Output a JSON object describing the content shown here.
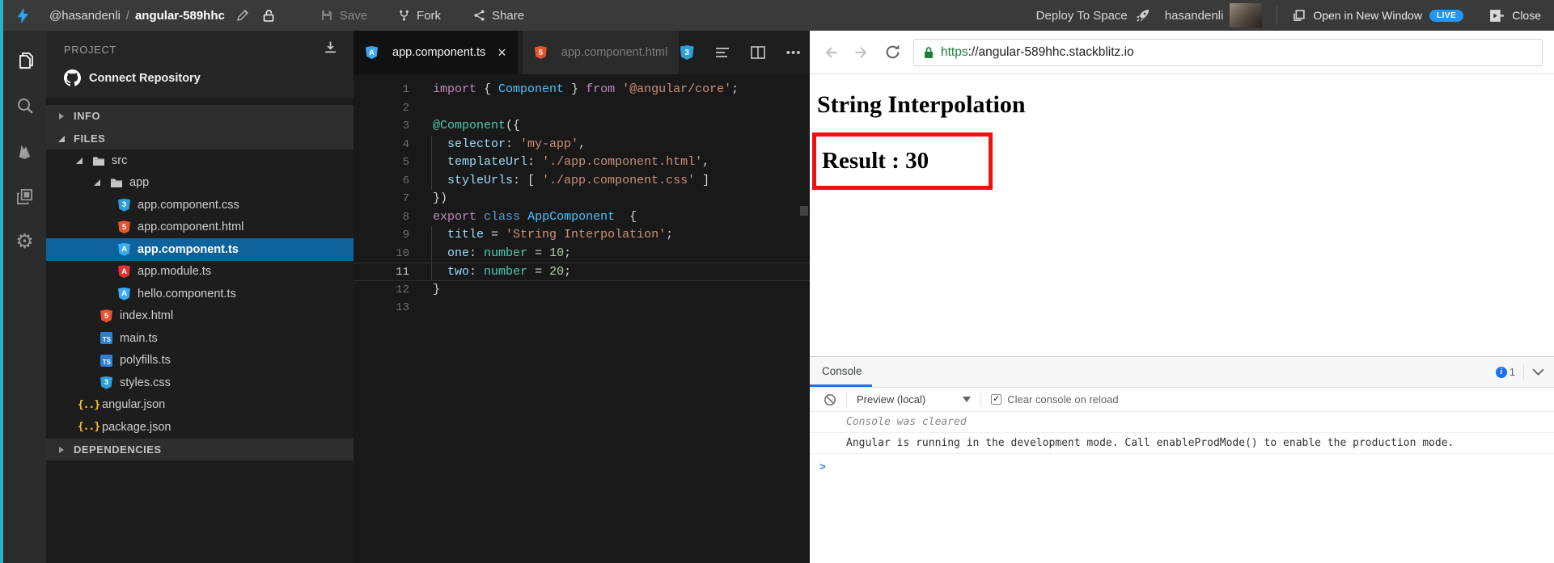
{
  "topbar": {
    "username": "@hasandenli",
    "separator": "/",
    "project_name": "angular-589hhc",
    "save_label": "Save",
    "fork_label": "Fork",
    "share_label": "Share",
    "deploy_label": "Deploy To Space",
    "user_display_name": "hasandenli",
    "open_in_new_window_label": "Open in New Window",
    "live_badge": "LIVE",
    "close_label": "Close"
  },
  "activity_bar": {
    "icons": [
      "files-icon",
      "search-icon",
      "firebase-icon",
      "extensions-icon",
      "settings-icon"
    ]
  },
  "project_panel": {
    "title": "PROJECT",
    "connect_repository_label": "Connect Repository",
    "tree": [
      {
        "label": "INFO",
        "kind": "section",
        "state": "collapsed"
      },
      {
        "label": "FILES",
        "kind": "section",
        "state": "expanded"
      },
      {
        "label": "src",
        "kind": "folder",
        "indent": 1,
        "state": "expanded"
      },
      {
        "label": "app",
        "kind": "folder",
        "indent": 2,
        "state": "expanded"
      },
      {
        "label": "app.component.css",
        "kind": "file",
        "icon": "css3-icon",
        "indent": 3
      },
      {
        "label": "app.component.html",
        "kind": "file",
        "icon": "html5-icon",
        "indent": 3
      },
      {
        "label": "app.component.ts",
        "kind": "file",
        "icon": "angular-blue-icon",
        "indent": 3,
        "selected": true
      },
      {
        "label": "app.module.ts",
        "kind": "file",
        "icon": "angular-red-icon",
        "indent": 3
      },
      {
        "label": "hello.component.ts",
        "kind": "file",
        "icon": "angular-blue-icon",
        "indent": 3
      },
      {
        "label": "index.html",
        "kind": "file",
        "icon": "html5-icon",
        "indent": 2
      },
      {
        "label": "main.ts",
        "kind": "file",
        "icon": "typescript-icon",
        "indent": 2
      },
      {
        "label": "polyfills.ts",
        "kind": "file",
        "icon": "typescript-icon",
        "indent": 2
      },
      {
        "label": "styles.css",
        "kind": "file",
        "icon": "css3-icon",
        "indent": 2
      },
      {
        "label": "angular.json",
        "kind": "file",
        "icon": "json-braces-icon",
        "indent": 1
      },
      {
        "label": "package.json",
        "kind": "file",
        "icon": "json-braces-icon",
        "indent": 1
      },
      {
        "label": "DEPENDENCIES",
        "kind": "section",
        "state": "collapsed"
      }
    ]
  },
  "editor": {
    "tabs": [
      {
        "label": "app.component.ts",
        "icon": "angular-blue-icon",
        "active": true,
        "closable": true
      },
      {
        "label": "app.component.html",
        "icon": "html5-icon",
        "active": false,
        "closable": false
      }
    ],
    "code_lines": [
      {
        "num": "1",
        "tokens": [
          [
            "kw",
            "import"
          ],
          [
            "pun",
            " { "
          ],
          [
            "ent",
            "Component"
          ],
          [
            "pun",
            " } "
          ],
          [
            "kw",
            "from"
          ],
          [
            "pun",
            " "
          ],
          [
            "str",
            "'@angular/core'"
          ],
          [
            "pun",
            ";"
          ]
        ]
      },
      {
        "num": "2",
        "tokens": []
      },
      {
        "num": "3",
        "tokens": [
          [
            "deco",
            "@Component"
          ],
          [
            "pun",
            "({"
          ]
        ]
      },
      {
        "num": "4",
        "guide": true,
        "tokens": [
          [
            "pun",
            "  "
          ],
          [
            "prop",
            "selector"
          ],
          [
            "pun",
            ": "
          ],
          [
            "str",
            "'my-app'"
          ],
          [
            "pun",
            ","
          ]
        ]
      },
      {
        "num": "5",
        "guide": true,
        "tokens": [
          [
            "pun",
            "  "
          ],
          [
            "prop",
            "templateUrl"
          ],
          [
            "pun",
            ": "
          ],
          [
            "str",
            "'./app.component.html'"
          ],
          [
            "pun",
            ","
          ]
        ]
      },
      {
        "num": "6",
        "guide": true,
        "tokens": [
          [
            "pun",
            "  "
          ],
          [
            "prop",
            "styleUrls"
          ],
          [
            "pun",
            ": [ "
          ],
          [
            "str",
            "'./app.component.css'"
          ],
          [
            "pun",
            " ]"
          ]
        ]
      },
      {
        "num": "7",
        "tokens": [
          [
            "pun",
            "})"
          ]
        ]
      },
      {
        "num": "8",
        "tokens": [
          [
            "kw",
            "export"
          ],
          [
            "pun",
            " "
          ],
          [
            "kw2",
            "class"
          ],
          [
            "pun",
            " "
          ],
          [
            "ent",
            "AppComponent"
          ],
          [
            "pun",
            "  {"
          ]
        ]
      },
      {
        "num": "9",
        "guide": true,
        "tokens": [
          [
            "pun",
            "  "
          ],
          [
            "prop",
            "title"
          ],
          [
            "pun",
            " = "
          ],
          [
            "str",
            "'String Interpolation'"
          ],
          [
            "pun",
            ";"
          ]
        ]
      },
      {
        "num": "10",
        "guide": true,
        "tokens": [
          [
            "pun",
            "  "
          ],
          [
            "prop",
            "one"
          ],
          [
            "pun",
            ": "
          ],
          [
            "type",
            "number"
          ],
          [
            "pun",
            " = "
          ],
          [
            "num",
            "10"
          ],
          [
            "pun",
            ";"
          ]
        ]
      },
      {
        "num": "11",
        "guide": true,
        "active": true,
        "tokens": [
          [
            "pun",
            "  "
          ],
          [
            "prop",
            "two"
          ],
          [
            "pun",
            ": "
          ],
          [
            "type",
            "number"
          ],
          [
            "pun",
            " = "
          ],
          [
            "num",
            "20"
          ],
          [
            "pun",
            ";"
          ]
        ]
      },
      {
        "num": "12",
        "tokens": [
          [
            "pun",
            "}"
          ]
        ]
      },
      {
        "num": "13",
        "tokens": []
      }
    ]
  },
  "preview": {
    "url_scheme": "https",
    "url_rest": "://angular-589hhc.stackblitz.io",
    "heading": "String Interpolation",
    "result_text": "Result : 30"
  },
  "console": {
    "tab_label": "Console",
    "info_count": "1",
    "dropdown_value": "Preview (local)",
    "clear_checkbox_label": "Clear console on reload",
    "checkbox_checked": true,
    "messages": [
      {
        "text": "Console was cleared",
        "style": "muted"
      },
      {
        "text": "Angular is running in the development mode. Call enableProdMode() to enable the production mode.",
        "style": "normal"
      }
    ],
    "prompt": ">"
  },
  "colors": {
    "edge_accent_teal": "#2ab3c4",
    "live_badge_blue": "#2196f3",
    "selected_file_blue": "#0e639c",
    "console_tab_underline": "#1a73e8",
    "url_https_green": "#188038",
    "result_border_red": "#ee1111",
    "stackblitz_bolt_blue": "#29a8f5"
  }
}
